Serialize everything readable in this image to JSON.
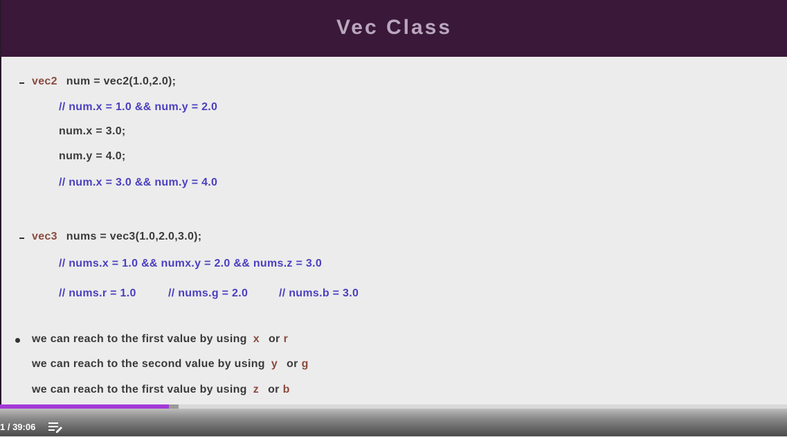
{
  "slide": {
    "title": "Vec Class",
    "vec2": {
      "type": "vec2",
      "decl": "num = vec2(1.0,2.0);",
      "comment1": "// num.x = 1.0 && num.y = 2.0",
      "assign_x": "num.x = 3.0;",
      "assign_y": "num.y = 4.0;",
      "comment2": "// num.x = 3.0 && num.y = 4.0"
    },
    "vec3": {
      "type": "vec3",
      "decl": "nums = vec3(1.0,2.0,3.0);",
      "comment1": "// nums.x = 1.0 && numx.y = 2.0 && nums.z = 3.0",
      "comment_r": "// nums.r = 1.0",
      "comment_g": "// nums.g = 2.0",
      "comment_b": "// nums.b = 3.0"
    },
    "bullets": [
      {
        "text": "we can reach to the first value by using",
        "a": "x",
        "or": "or",
        "b": "r"
      },
      {
        "text": "we can reach to the second value by using",
        "a": "y",
        "or": "or",
        "b": "g"
      },
      {
        "text": "we can reach to the first value by using",
        "a": "z",
        "or": "or",
        "b": "b"
      }
    ]
  },
  "player": {
    "time_display": "1 / 39:06",
    "progress": 0.215,
    "accent_color": "#a23ad6",
    "chapters_icon": "chapters-list-icon"
  }
}
